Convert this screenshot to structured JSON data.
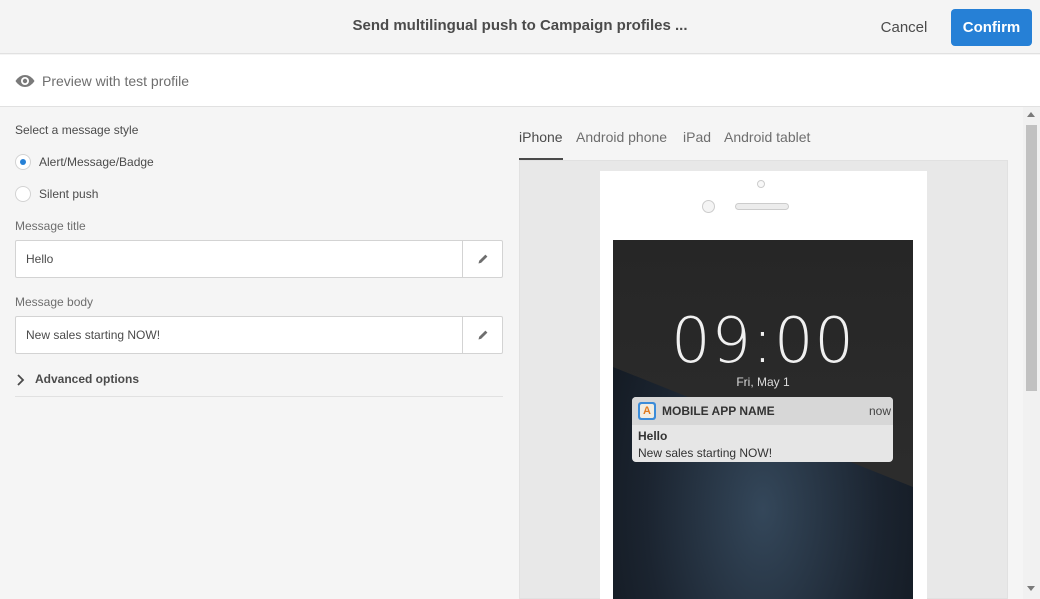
{
  "header": {
    "title": "Send multilingual push to Campaign profiles ...",
    "cancel_label": "Cancel",
    "confirm_label": "Confirm"
  },
  "preview_bar": {
    "icon": "eye-icon",
    "label": "Preview with test profile"
  },
  "form": {
    "style_label": "Select a message style",
    "styles": [
      {
        "label": "Alert/Message/Badge",
        "selected": true
      },
      {
        "label": "Silent push",
        "selected": false
      }
    ],
    "title_label": "Message title",
    "title_value": "Hello",
    "body_label": "Message body",
    "body_value": "New sales starting NOW!",
    "edit_icon": "pencil-icon",
    "advanced_label": "Advanced options",
    "advanced_icon": "chevron-right-icon"
  },
  "devices": {
    "tabs": [
      "iPhone",
      "Android phone",
      "iPad",
      "Android tablet"
    ],
    "active_tab": "iPhone"
  },
  "phone_screen": {
    "time": "09:00",
    "date": "Fri, May 1",
    "notification": {
      "app_icon_letter": "A",
      "app_name": "MOBILE APP NAME",
      "time": "now",
      "title": "Hello",
      "body": "New sales starting NOW!"
    }
  },
  "colors": {
    "accent": "#2680d6",
    "header_bg": "#f4f4f4",
    "panel_bg": "#f5f5f5"
  }
}
